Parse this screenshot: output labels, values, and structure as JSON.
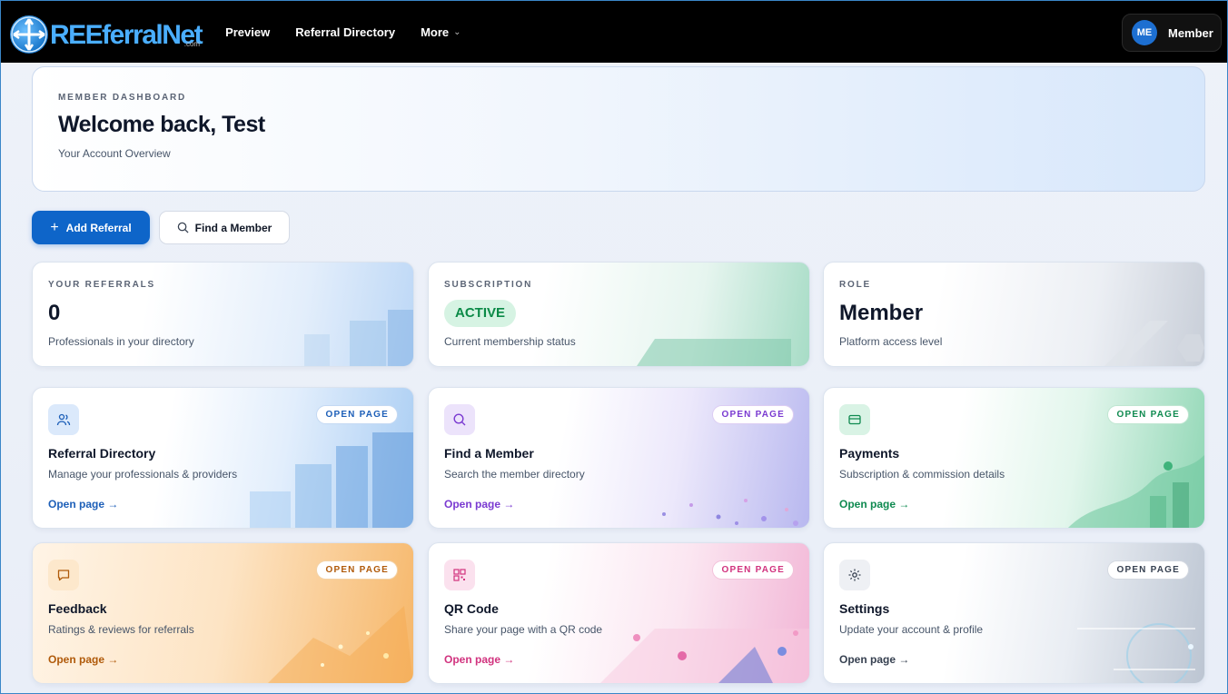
{
  "brand": {
    "name": "REEferralNet",
    "suffix": ".com"
  },
  "nav": {
    "items": [
      {
        "label": "Preview"
      },
      {
        "label": "Referral Directory"
      },
      {
        "label": "More"
      }
    ],
    "user": {
      "initials": "ME",
      "label": "Member"
    }
  },
  "hero": {
    "eyebrow": "MEMBER DASHBOARD",
    "title": "Welcome back, Test",
    "subtitle": "Your Account Overview"
  },
  "actions": {
    "add_referral": "Add Referral",
    "find_member": "Find a Member"
  },
  "stats": [
    {
      "label": "YOUR REFERRALS",
      "value": "0",
      "desc": "Professionals in your directory"
    },
    {
      "label": "SUBSCRIPTION",
      "value": "ACTIVE",
      "desc": "Current membership status"
    },
    {
      "label": "ROLE",
      "value": "Member",
      "desc": "Platform access level"
    }
  ],
  "cards": [
    {
      "title": "Referral Directory",
      "desc": "Manage your professionals & providers",
      "badge": "OPEN PAGE",
      "link": "Open page →",
      "icon": "users-icon",
      "accent": "#1d5fb8"
    },
    {
      "title": "Find a Member",
      "desc": "Search the member directory",
      "badge": "OPEN PAGE",
      "link": "Open page →",
      "icon": "search-icon",
      "accent": "#7a3ad1"
    },
    {
      "title": "Payments",
      "desc": "Subscription & commission details",
      "badge": "OPEN PAGE",
      "link": "Open page →",
      "icon": "credit-card-icon",
      "accent": "#0f8a50"
    },
    {
      "title": "Feedback",
      "desc": "Ratings & reviews for referrals",
      "badge": "OPEN PAGE",
      "link": "Open page →",
      "icon": "chat-bubble-icon",
      "accent": "#b05a0a"
    },
    {
      "title": "QR Code",
      "desc": "Share your page with a QR code",
      "badge": "OPEN PAGE",
      "link": "Open page →",
      "icon": "qr-code-icon",
      "accent": "#d1327e"
    },
    {
      "title": "Settings",
      "desc": "Update your account & profile",
      "badge": "OPEN PAGE",
      "link": "Open page →",
      "icon": "gear-icon",
      "accent": "#374151"
    }
  ]
}
